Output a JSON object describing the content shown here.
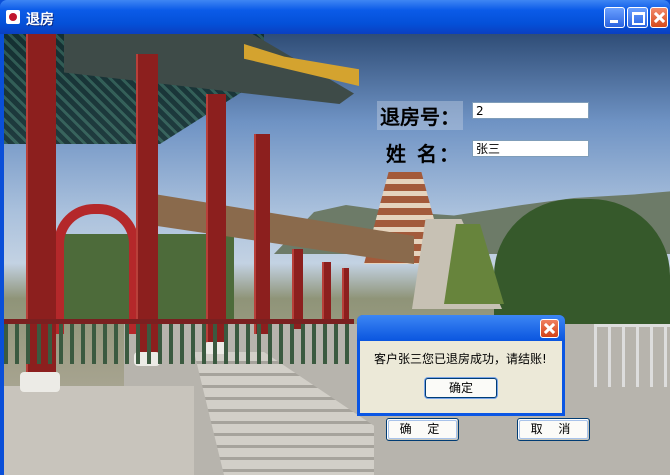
{
  "window": {
    "title": "退房",
    "icon": "app-icon",
    "controls": [
      "minimize-icon",
      "maximize-icon",
      "close-icon"
    ],
    "title_bar_color": "#0a55df"
  },
  "form": {
    "room_label": "退房号：",
    "room_value": "2",
    "name_label": "姓 名：",
    "name_value": "张三",
    "confirm_label": "确 定",
    "cancel_label": "取 消"
  },
  "dialog": {
    "message": "客户张三您已退房成功，请结账!",
    "ok_label": "确定",
    "close_icon": "close-icon"
  }
}
